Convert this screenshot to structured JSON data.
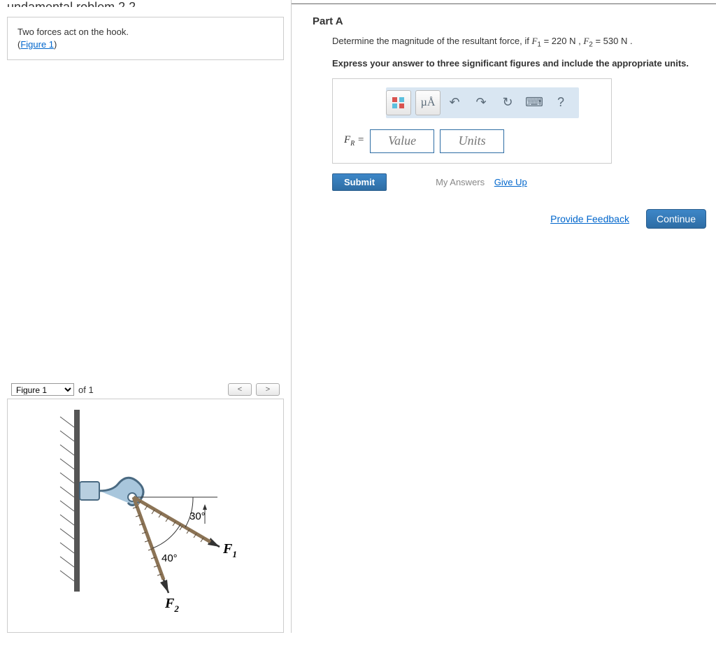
{
  "problem": {
    "prompt_line1": "Two forces act on the hook.",
    "prompt_line2_prefix": "(",
    "figure_link": "Figure 1",
    "prompt_line2_suffix": ")"
  },
  "figure": {
    "select_label": "Figure 1",
    "of_label": "of 1",
    "prev": "<",
    "next": ">",
    "angle1": "30°",
    "angle2": "40°",
    "F1": "F",
    "F1_sub": "1",
    "F2": "F",
    "F2_sub": "2"
  },
  "partA": {
    "label": "Part A",
    "question_pre": "Determine the magnitude of the resultant force, if ",
    "F1_sym": "F",
    "F1_sub": "1",
    "F1_val": " = 220 N ",
    "sep": ", ",
    "F2_sym": "F",
    "F2_sub": "2",
    "F2_val": " = 530 N .",
    "instruction": "Express your answer to three significant figures and include the appropriate units.",
    "toolbar": {
      "templates_icon": "templates-icon",
      "units_hint": "µÅ",
      "undo": "↶",
      "redo": "↷",
      "reset": "↻",
      "keyboard": "⌨",
      "help": "?"
    },
    "fr_label_main": "F",
    "fr_label_sub": "R",
    "fr_eq": " = ",
    "value_ph": "Value",
    "units_ph": "Units",
    "submit": "Submit",
    "my_answers": "My Answers",
    "give_up": "Give Up"
  },
  "footer": {
    "feedback": "Provide Feedback",
    "continue": "Continue"
  }
}
